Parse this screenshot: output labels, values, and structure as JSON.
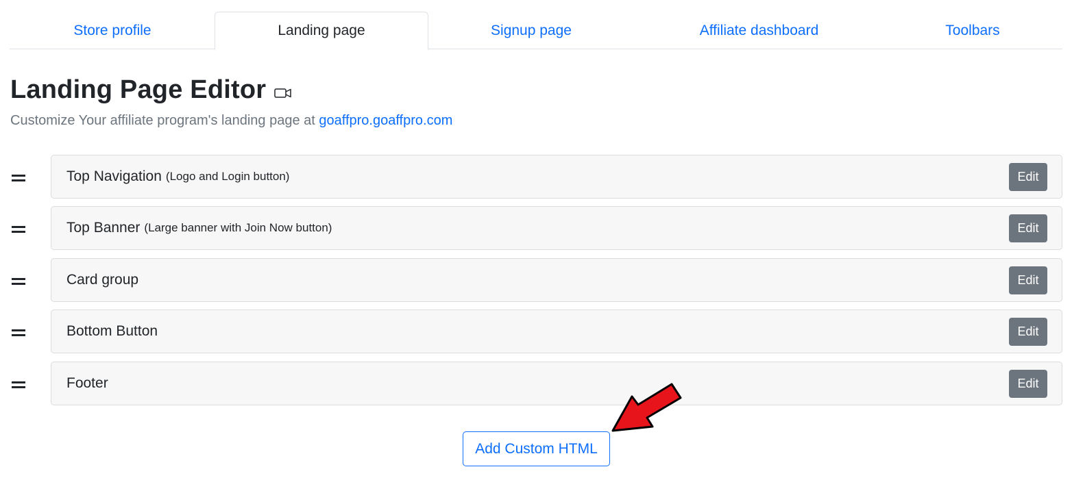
{
  "tabs": [
    {
      "label": "Store profile",
      "active": false
    },
    {
      "label": "Landing page",
      "active": true
    },
    {
      "label": "Signup page",
      "active": false
    },
    {
      "label": "Affiliate dashboard",
      "active": false
    },
    {
      "label": "Toolbars",
      "active": false
    }
  ],
  "header": {
    "title": "Landing Page Editor",
    "title_icon": "video-camera-icon",
    "subtitle_prefix": "Customize Your affiliate program's landing page at",
    "subtitle_link": "goaffpro.goaffpro.com"
  },
  "sections": [
    {
      "name": "Top Navigation",
      "description": "(Logo and Login button)",
      "edit_label": "Edit"
    },
    {
      "name": "Top Banner",
      "description": "(Large banner with Join Now button)",
      "edit_label": "Edit"
    },
    {
      "name": "Card group",
      "description": "",
      "edit_label": "Edit"
    },
    {
      "name": "Bottom Button",
      "description": "",
      "edit_label": "Edit"
    },
    {
      "name": "Footer",
      "description": "",
      "edit_label": "Edit"
    }
  ],
  "add_button_label": "Add Custom HTML",
  "annotation": {
    "icon": "red-arrow-icon",
    "color": "#e8141c"
  },
  "colors": {
    "link": "#0d6efd",
    "edit_button": "#6c757d",
    "card_bg": "#f7f7f7",
    "muted_text": "#6c757d"
  }
}
